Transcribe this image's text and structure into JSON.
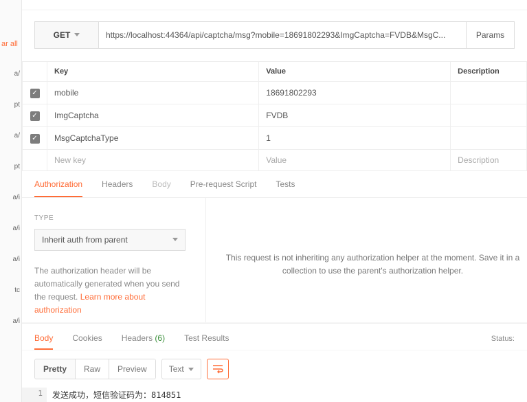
{
  "left_panel": {
    "clear_all": "ar all",
    "items": [
      "a/",
      "pt",
      "a/",
      "pt",
      "a/i",
      "a/i",
      "a/i",
      "tc",
      "a/i"
    ]
  },
  "request": {
    "method": "GET",
    "url": "https://localhost:44364/api/captcha/msg?mobile=18691802293&ImgCaptcha=FVDB&MsgC...",
    "params_btn": "Params"
  },
  "params": {
    "headers": {
      "key": "Key",
      "value": "Value",
      "desc": "Description"
    },
    "rows": [
      {
        "checked": true,
        "key": "mobile",
        "value": "18691802293"
      },
      {
        "checked": true,
        "key": "ImgCaptcha",
        "value": "FVDB"
      },
      {
        "checked": true,
        "key": "MsgCaptchaType",
        "value": "1"
      }
    ],
    "placeholder": {
      "key": "New key",
      "value": "Value",
      "desc": "Description"
    }
  },
  "req_tabs": {
    "auth": "Authorization",
    "headers": "Headers",
    "body": "Body",
    "prerequest": "Pre-request Script",
    "tests": "Tests"
  },
  "auth": {
    "type_label": "TYPE",
    "select_value": "Inherit auth from parent",
    "desc_1": "The authorization header will be automatically generated when you send the request. ",
    "link": "Learn more about authorization",
    "right_msg": "This request is not inheriting any authorization helper at the moment. Save it in a collection to use the parent's authorization helper."
  },
  "resp_tabs": {
    "body": "Body",
    "cookies": "Cookies",
    "headers": "Headers",
    "headers_count": "(6)",
    "test_results": "Test Results",
    "status_label": "Status:"
  },
  "resp_toolbar": {
    "pretty": "Pretty",
    "raw": "Raw",
    "preview": "Preview",
    "text": "Text"
  },
  "resp_body": {
    "line_no": "1",
    "content": "发送成功，短信验证码为：814851"
  }
}
